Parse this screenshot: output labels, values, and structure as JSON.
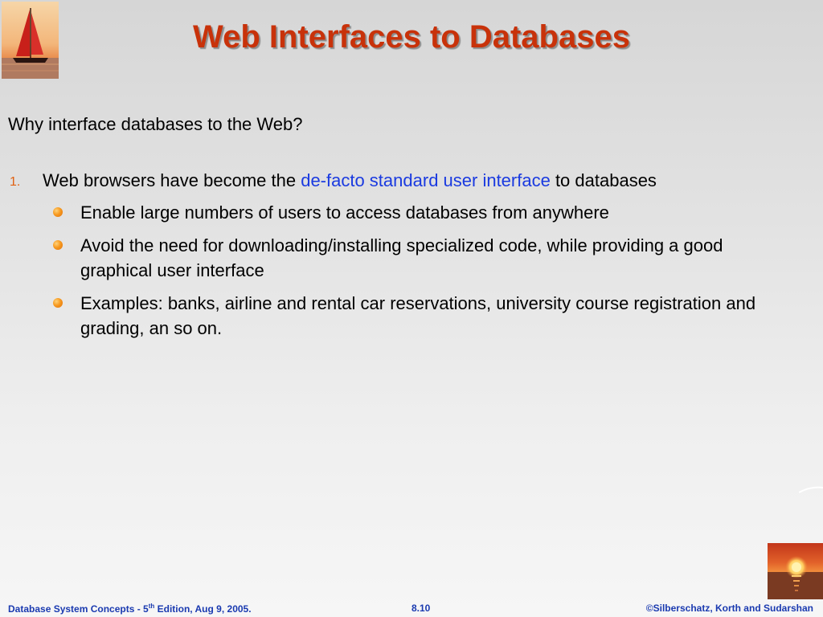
{
  "slide": {
    "title": "Web Interfaces to Databases",
    "intro": "Why interface databases to the Web?",
    "numbered_item": {
      "number": "1.",
      "text_before": "Web browsers have become the ",
      "highlight": "de-facto standard user interface",
      "text_after": " to databases"
    },
    "bullets": [
      "Enable large numbers of users to access databases from anywhere",
      "Avoid the need for downloading/installing specialized code, while providing a good graphical user interface",
      "Examples: banks, airline and rental car reservations, university course registration and grading, an so on."
    ]
  },
  "footer": {
    "left_prefix": "Database System Concepts - 5",
    "left_sup": "th",
    "left_suffix": " Edition,  Aug 9, 2005.",
    "center": "8.10",
    "right": "©Silberschatz, Korth and Sudarshan"
  },
  "colors": {
    "title": "#c8320a",
    "highlight": "#1a3ae0",
    "bullet": "#f79a20",
    "footer": "#1a3ab0"
  },
  "icons": {
    "top_left": "sailboat-logo-icon",
    "bottom_right": "sunset-logo-icon"
  }
}
